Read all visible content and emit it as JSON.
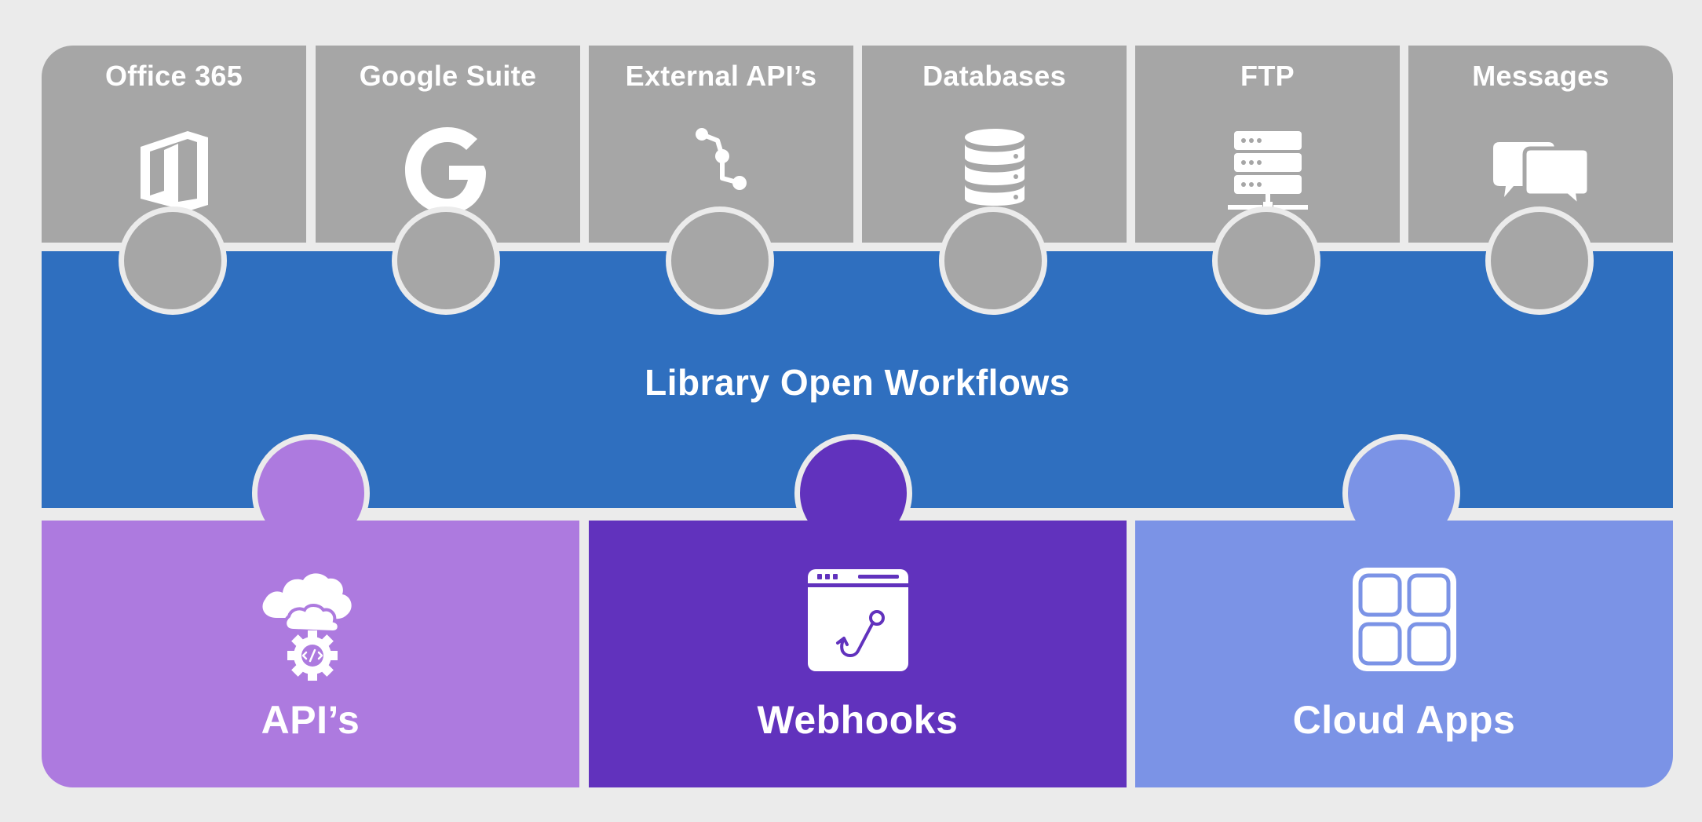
{
  "integrations": [
    {
      "label": "Office 365",
      "icon": "office-365-icon"
    },
    {
      "label": "Google Suite",
      "icon": "google-g-icon"
    },
    {
      "label": "External API’s",
      "icon": "api-connector-icon"
    },
    {
      "label": "Databases",
      "icon": "database-icon"
    },
    {
      "label": "FTP",
      "icon": "server-network-icon"
    },
    {
      "label": "Messages",
      "icon": "chat-bubbles-icon"
    }
  ],
  "hub": {
    "title": "Library Open Workflows",
    "color": "#2f6fbf"
  },
  "channels": [
    {
      "label": "API’s",
      "icon": "cloud-gear-code-icon",
      "color": "#ad7adf"
    },
    {
      "label": "Webhooks",
      "icon": "browser-hook-icon",
      "color": "#6132bd"
    },
    {
      "label": "Cloud Apps",
      "icon": "app-grid-icon",
      "color": "#7b93e6"
    }
  ],
  "colors": {
    "background": "#ebebeb",
    "integration_tile": "#a6a6a6",
    "text": "#ffffff"
  }
}
